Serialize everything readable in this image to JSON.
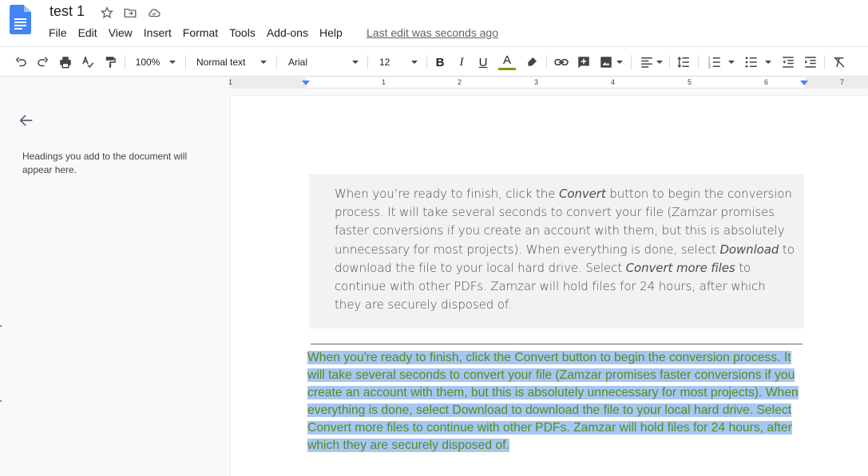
{
  "document": {
    "title": "test 1",
    "last_edit": "Last edit was seconds ago"
  },
  "menu": {
    "items": [
      "File",
      "Edit",
      "View",
      "Insert",
      "Format",
      "Tools",
      "Add-ons",
      "Help"
    ]
  },
  "toolbar": {
    "zoom": "100%",
    "style": "Normal text",
    "font": "Arial",
    "font_size": "12",
    "text_color_accent": "#7a9a00"
  },
  "ruler": {
    "numbers": [
      "1",
      "1",
      "2",
      "3",
      "4",
      "5",
      "6",
      "7"
    ]
  },
  "outline": {
    "hint": "Headings you add to the document will appear here."
  },
  "content": {
    "image_text": {
      "p1": "When you’re ready to finish, click the ",
      "convert": "Convert",
      "p2": " button to begin the conversion process. It will take several seconds to convert your file (Zamzar promises faster conversions if you create an account with them, but this is absolutely unnecessary for most projects). When everything is done, select ",
      "download": "Download",
      "p3": " to download the file to your local hard drive. Select ",
      "convert_more": "Convert more files",
      "p4": " to continue with other PDFs. Zamzar will hold files for 24 hours, after which they are securely disposed of."
    },
    "selected_paragraph": "When you're ready to finish, click the Convert button to begin the conversion process. It will take several seconds to convert your file (Zamzar promises faster conversions if you create an account with them, but this is absolutely unnecessary for most projects). When everything is done, select Download to download the file to your local hard drive. Select Convert more files to continue with other PDFs. Zamzar will hold files for 24 hours, after which they are securely disposed of."
  },
  "colors": {
    "docs_blue": "#4285f4",
    "selection": "#a6c7f2",
    "selected_text": "#5b8a1e"
  }
}
